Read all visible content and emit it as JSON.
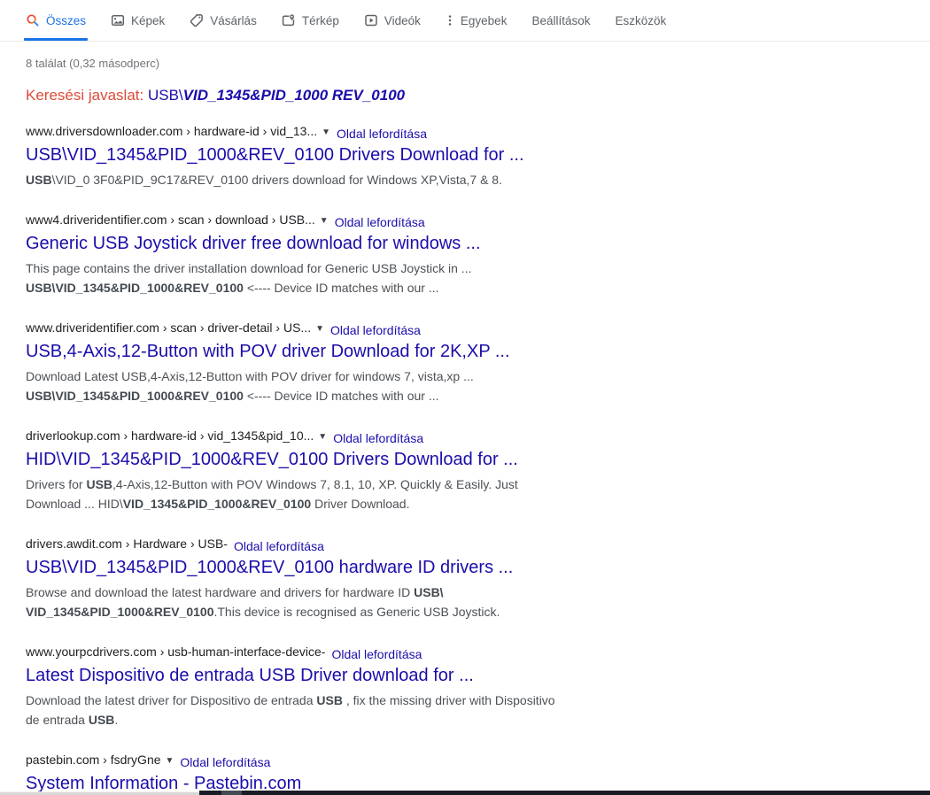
{
  "tabs": {
    "items": [
      {
        "name": "all",
        "label": "Összes",
        "icon": "search-icon",
        "active": true
      },
      {
        "name": "images",
        "label": "Képek",
        "icon": "images-icon",
        "active": false
      },
      {
        "name": "shopping",
        "label": "Vásárlás",
        "icon": "shopping-icon",
        "active": false
      },
      {
        "name": "maps",
        "label": "Térkép",
        "icon": "maps-icon",
        "active": false
      },
      {
        "name": "videos",
        "label": "Videók",
        "icon": "videos-icon",
        "active": false
      },
      {
        "name": "more",
        "label": "Egyebek",
        "icon": "more-icon",
        "active": false
      },
      {
        "name": "settings",
        "label": "Beállítások",
        "icon": null,
        "active": false
      },
      {
        "name": "tools",
        "label": "Eszközök",
        "icon": null,
        "active": false
      }
    ]
  },
  "stats": {
    "text": "8 találat (0,32 másodperc)"
  },
  "suggestion": {
    "label": "Keresési javaslat:",
    "query_plain": "USB\\",
    "query_emphasis": "VID_1345&PID_1000 REV_0100"
  },
  "ui": {
    "translate_label": "Oldal lefordítása",
    "chevron_glyph": "▼"
  },
  "colors": {
    "link_blue": "#1a0dab",
    "active_tab_blue": "#1a73e8",
    "suggestion_red": "#dd4b39",
    "tab_gray": "#5f6368",
    "stats_gray": "#70757a",
    "snippet_gray": "#4d5156"
  },
  "results": [
    {
      "breadcrumb": "www.driversdownloader.com › hardware-id › vid_13...",
      "has_arrow": true,
      "title": "USB\\VID_1345&PID_1000&REV_0100 Drivers Download for ...",
      "snippet": [
        {
          "text": "USB",
          "bold": true,
          "br": false
        },
        {
          "text": "\\VID_0 3F0&PID_9C17&REV_0100 drivers download for Windows XP,Vista,7 & 8.",
          "bold": false,
          "br": false
        }
      ]
    },
    {
      "breadcrumb": "www4.driveridentifier.com › scan › download › USB...",
      "has_arrow": true,
      "title": "Generic USB Joystick driver free download for windows ...",
      "snippet": [
        {
          "text": "This page contains the driver installation download for Generic USB Joystick in ...",
          "bold": false,
          "br": true
        },
        {
          "text": "USB\\VID_1345&PID_1000&REV_0100",
          "bold": true,
          "br": false
        },
        {
          "text": " <---- Device ID matches with our ...",
          "bold": false,
          "br": false
        }
      ]
    },
    {
      "breadcrumb": "www.driveridentifier.com › scan › driver-detail › US...",
      "has_arrow": true,
      "title": "USB,4-Axis,12-Button with POV driver Download for 2K,XP ...",
      "snippet": [
        {
          "text": "Download Latest USB,4-Axis,12-Button with POV driver for windows 7, vista,xp ...",
          "bold": false,
          "br": true
        },
        {
          "text": "USB\\VID_1345&PID_1000&REV_0100",
          "bold": true,
          "br": false
        },
        {
          "text": " <---- Device ID matches with our ...",
          "bold": false,
          "br": false
        }
      ]
    },
    {
      "breadcrumb": "driverlookup.com › hardware-id › vid_1345&pid_10...",
      "has_arrow": true,
      "title": "HID\\VID_1345&PID_1000&REV_0100 Drivers Download for ...",
      "snippet": [
        {
          "text": "Drivers for ",
          "bold": false,
          "br": false
        },
        {
          "text": "USB",
          "bold": true,
          "br": false
        },
        {
          "text": ",4-Axis,12-Button with POV Windows 7, 8.1, 10, XP. Quickly & Easily. Just",
          "bold": false,
          "br": true
        },
        {
          "text": "Download ... HID\\",
          "bold": false,
          "br": false
        },
        {
          "text": "VID_1345&PID_1000&REV_0100",
          "bold": true,
          "br": false
        },
        {
          "text": " Driver Download.",
          "bold": false,
          "br": false
        }
      ]
    },
    {
      "breadcrumb": "drivers.awdit.com › Hardware › USB-",
      "has_arrow": false,
      "title": "USB\\VID_1345&PID_1000&REV_0100 hardware ID drivers ...",
      "snippet": [
        {
          "text": "Browse and download the latest hardware and drivers for hardware ID ",
          "bold": false,
          "br": false
        },
        {
          "text": "USB\\",
          "bold": true,
          "br": true
        },
        {
          "text": "VID_1345&PID_1000&REV_0100",
          "bold": true,
          "br": false
        },
        {
          "text": ".This device is recognised as Generic USB Joystick.",
          "bold": false,
          "br": false
        }
      ]
    },
    {
      "breadcrumb": "www.yourpcdrivers.com › usb-human-interface-device-",
      "has_arrow": false,
      "title": "Latest Dispositivo de entrada USB Driver download for ...",
      "snippet": [
        {
          "text": "Download the latest driver for Dispositivo de entrada ",
          "bold": false,
          "br": false
        },
        {
          "text": "USB",
          "bold": true,
          "br": false
        },
        {
          "text": " , fix the missing driver with Dispositivo",
          "bold": false,
          "br": true
        },
        {
          "text": "de entrada ",
          "bold": false,
          "br": false
        },
        {
          "text": "USB",
          "bold": true,
          "br": false
        },
        {
          "text": ".",
          "bold": false,
          "br": false
        }
      ]
    },
    {
      "breadcrumb": "pastebin.com › fsdryGne",
      "has_arrow": true,
      "title": "System Information - Pastebin.com",
      "snippet": []
    }
  ]
}
